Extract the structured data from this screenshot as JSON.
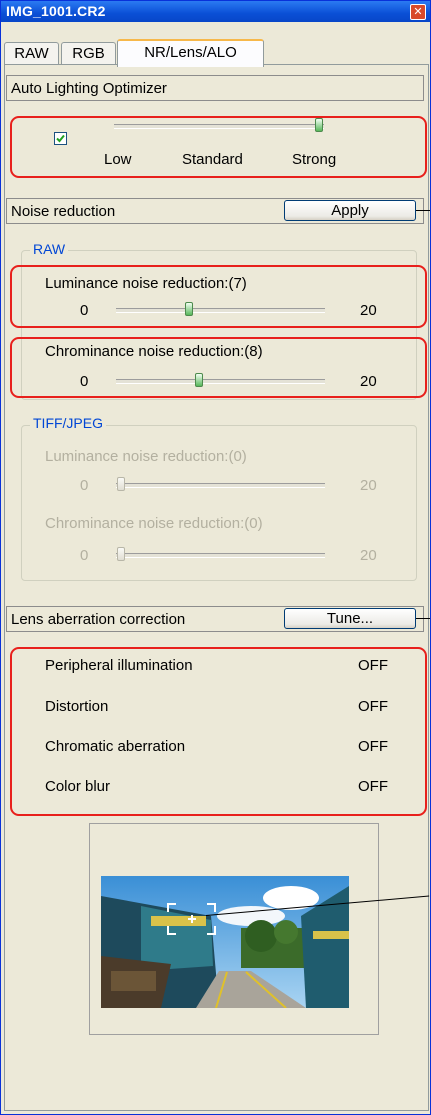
{
  "window": {
    "title": "IMG_1001.CR2",
    "close_glyph": "✕"
  },
  "tabs": [
    {
      "label": "RAW"
    },
    {
      "label": "RGB"
    },
    {
      "label": "NR/Lens/ALO"
    }
  ],
  "alo": {
    "header": "Auto Lighting Optimizer",
    "checked": true,
    "levels": [
      "Low",
      "Standard",
      "Strong"
    ],
    "selected_level": "Strong"
  },
  "noise": {
    "header": "Noise reduction",
    "apply_label": "Apply",
    "raw": {
      "title": "RAW",
      "luminance": {
        "label": "Luminance noise reduction:(7)",
        "min": "0",
        "max": "20",
        "value": 7
      },
      "chrominance": {
        "label": "Chrominance noise reduction:(8)",
        "min": "0",
        "max": "20",
        "value": 8
      }
    },
    "tiff": {
      "title": "TIFF/JPEG",
      "luminance": {
        "label": "Luminance noise reduction:(0)",
        "min": "0",
        "max": "20",
        "value": 0
      },
      "chrominance": {
        "label": "Chrominance noise reduction:(0)",
        "min": "0",
        "max": "20",
        "value": 0
      }
    }
  },
  "lens": {
    "header": "Lens aberration correction",
    "tune_label": "Tune...",
    "items": [
      {
        "label": "Peripheral illumination",
        "value": "OFF"
      },
      {
        "label": "Distortion",
        "value": "OFF"
      },
      {
        "label": "Chromatic aberration",
        "value": "OFF"
      },
      {
        "label": "Color blur",
        "value": "OFF"
      }
    ]
  },
  "colors": {
    "highlight_outline": "#e8201c",
    "titlebar": "#0a4fd6",
    "slider_thumb": "#57b85a"
  }
}
